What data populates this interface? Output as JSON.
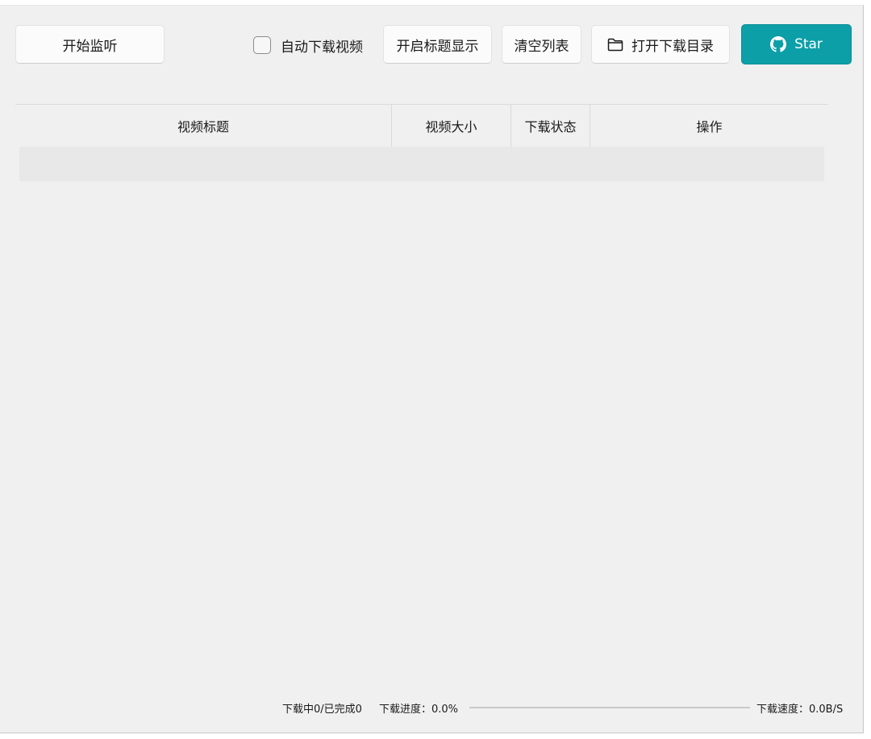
{
  "toolbar": {
    "start_listen_label": "开始监听",
    "auto_download_label": "自动下载视频",
    "auto_download_checked": false,
    "show_title_label": "开启标题显示",
    "clear_list_label": "清空列表",
    "open_dir_label": "打开下载目录",
    "open_dir_icon": "folder-icon",
    "star_label": "Star",
    "star_icon": "github-icon",
    "accent_color": "#0c9fa8"
  },
  "table": {
    "columns": [
      "视频标题",
      "视频大小",
      "下载状态",
      "操作"
    ],
    "rows": []
  },
  "status": {
    "counts_text": "下载中0/已完成0",
    "progress_text": "下载进度：0.0%",
    "progress_value": 0.0,
    "speed_text": "下载速度：0.0B/S"
  }
}
